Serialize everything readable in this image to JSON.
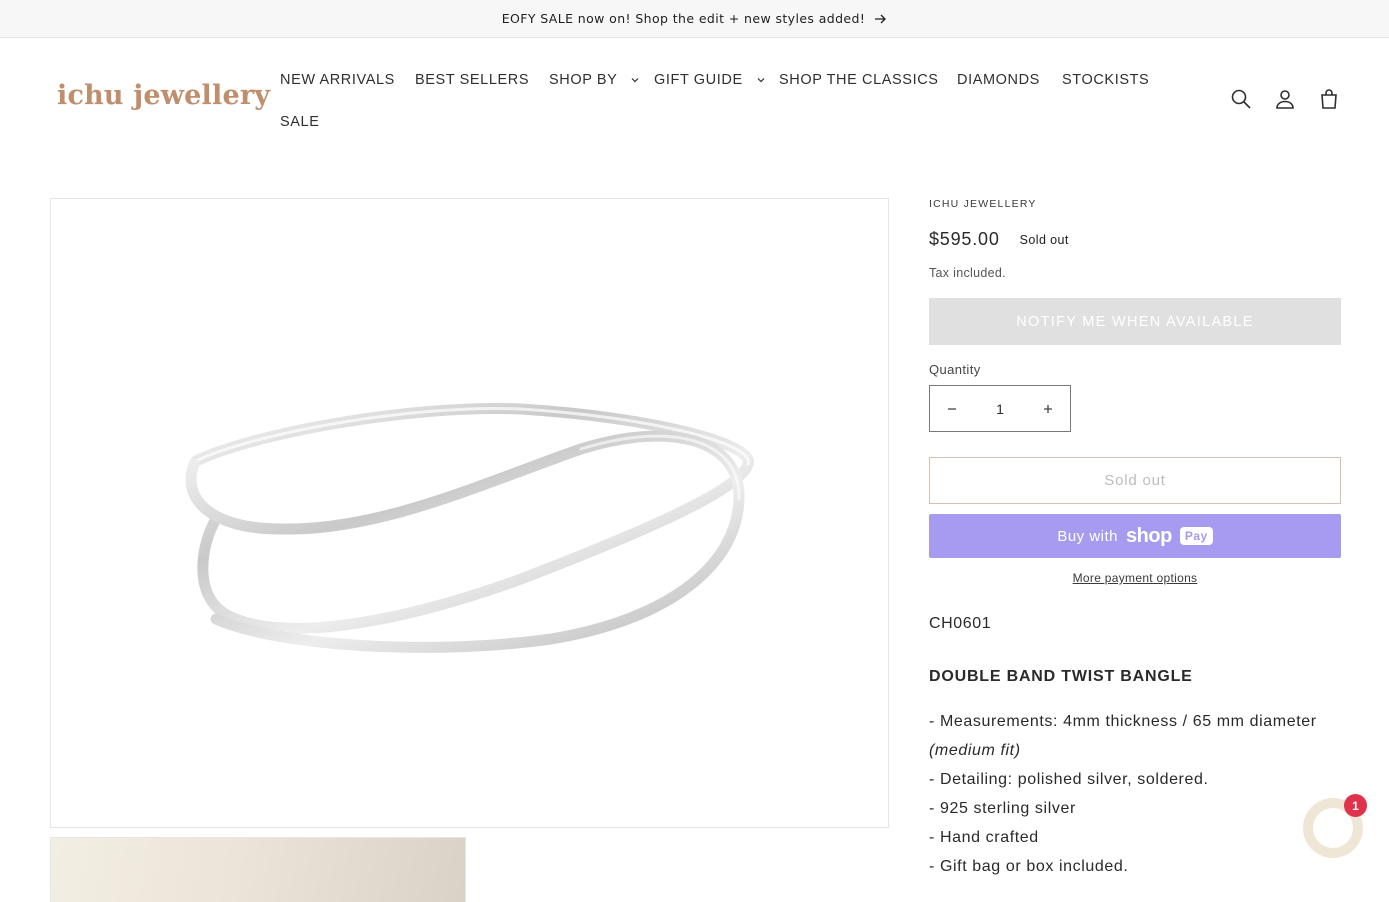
{
  "announcement": {
    "text": "EOFY SALE now on! Shop the edit + new styles added!"
  },
  "header": {
    "logo": "ichu jewellery",
    "nav": [
      {
        "label": "NEW ARRIVALS",
        "dropdown": false
      },
      {
        "label": "BEST SELLERS",
        "dropdown": false
      },
      {
        "label": "SHOP BY",
        "dropdown": true
      },
      {
        "label": "GIFT GUIDE",
        "dropdown": true
      },
      {
        "label": "SHOP THE CLASSICS",
        "dropdown": false
      },
      {
        "label": "DIAMONDS",
        "dropdown": false
      },
      {
        "label": "STOCKISTS",
        "dropdown": false
      },
      {
        "label": "SALE",
        "dropdown": false
      }
    ],
    "icons": [
      "search-icon",
      "account-icon",
      "cart-icon"
    ]
  },
  "product": {
    "vendor": "ICHU JEWELLERY",
    "price": "$595.00",
    "badge": "Sold out",
    "tax_note": "Tax included.",
    "notify_label": "NOTIFY ME WHEN AVAILABLE",
    "quantity_label": "Quantity",
    "quantity_value": "1",
    "sold_out_label": "Sold out",
    "buy_with_label": "Buy with",
    "shop_pay_shop": "shop",
    "shop_pay_pay": "Pay",
    "more_payment_label": "More payment options",
    "sku": "CH0601",
    "title": "DOUBLE BAND TWIST BANGLE",
    "description": {
      "measurements": "- Measurements: 4mm thickness / 65 mm diameter",
      "fit": "(medium fit)",
      "detailing": "- Detailing: polished silver, soldered.",
      "material": "- 925 sterling silver",
      "crafted": "- Hand crafted",
      "gift": "- Gift bag or box included."
    }
  },
  "chat": {
    "badge_count": "1"
  },
  "colors": {
    "logo": "#bf8e6c",
    "shop_pay": "#a69bf0",
    "notify_bg": "#e0e0e0",
    "chat_badge": "#e0324b",
    "chat_bubble": "#f0e6d6"
  }
}
